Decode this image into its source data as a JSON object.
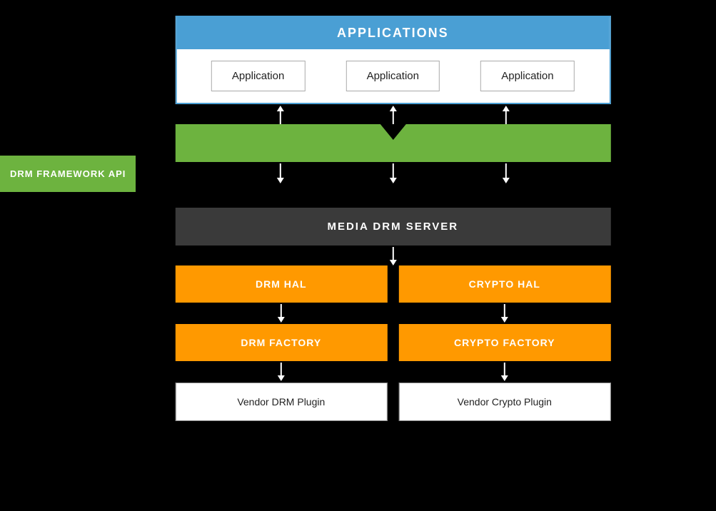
{
  "applications_header": "APPLICATIONS",
  "app1_label": "Application",
  "app2_label": "Application",
  "app3_label": "Application",
  "drm_framework_label": "DRM FRAMEWORK API",
  "media_drm_label": "MEDIA DRM SERVER",
  "drm_hal_label": "DRM HAL",
  "crypto_hal_label": "CRYPTO HAL",
  "drm_factory_label": "DRM FACTORY",
  "crypto_factory_label": "CRYPTO FACTORY",
  "vendor_drm_label": "Vendor DRM Plugin",
  "vendor_crypto_label": "Vendor Crypto Plugin",
  "colors": {
    "blue": "#4a9fd4",
    "green": "#6db33f",
    "orange": "#ff9900",
    "dark": "#3a3a3a"
  }
}
